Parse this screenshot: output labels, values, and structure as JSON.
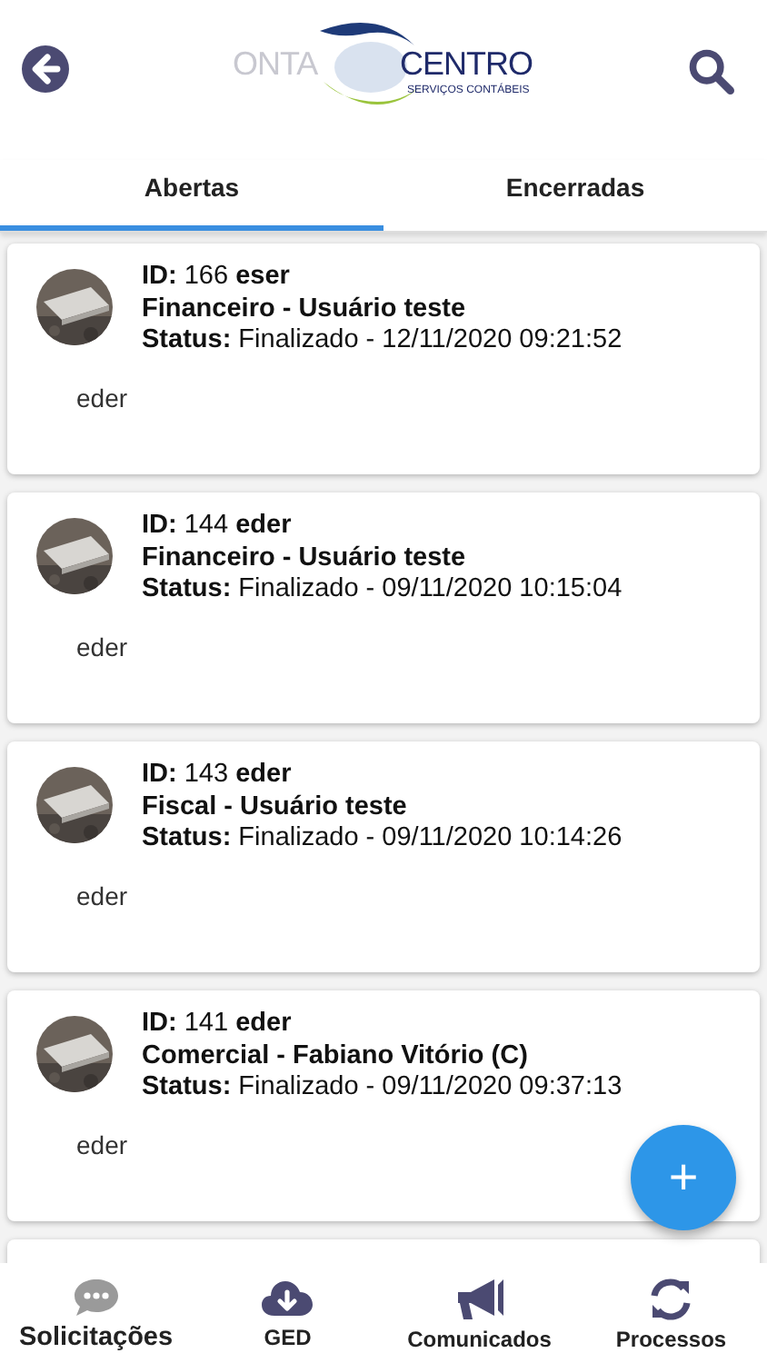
{
  "header": {
    "logo": {
      "left": "ONTA",
      "right": "CENTRO",
      "tagline": "SERVIÇOS CONTÁBEIS"
    }
  },
  "tabs": [
    {
      "label": "Abertas",
      "selected": true
    },
    {
      "label": "Encerradas",
      "selected": false
    }
  ],
  "tickets": [
    {
      "id_label": "ID:",
      "id": "166",
      "user": "eser",
      "title": "Financeiro - Usuário teste",
      "status_label": "Status:",
      "status": "Finalizado - 12/11/2020 09:21:52",
      "message": "eder"
    },
    {
      "id_label": "ID:",
      "id": "144",
      "user": "eder",
      "title": "Financeiro - Usuário teste",
      "status_label": "Status:",
      "status": "Finalizado - 09/11/2020 10:15:04",
      "message": "eder"
    },
    {
      "id_label": "ID:",
      "id": "143",
      "user": "eder",
      "title": "Fiscal - Usuário teste",
      "status_label": "Status:",
      "status": "Finalizado - 09/11/2020 10:14:26",
      "message": "eder"
    },
    {
      "id_label": "ID:",
      "id": "141",
      "user": "eder",
      "title": "Comercial - Fabiano Vitório (C)",
      "status_label": "Status:",
      "status": "Finalizado - 09/11/2020 09:37:13",
      "message": "eder"
    }
  ],
  "fab": {
    "label": "+"
  },
  "nav": [
    {
      "kind": "chat",
      "label": "Solicitações",
      "selected": true
    },
    {
      "kind": "cloud",
      "label": "GED",
      "selected": false
    },
    {
      "kind": "megaphone",
      "label": "Comunicados",
      "selected": false
    },
    {
      "kind": "sync",
      "label": "Processos",
      "selected": false
    }
  ]
}
